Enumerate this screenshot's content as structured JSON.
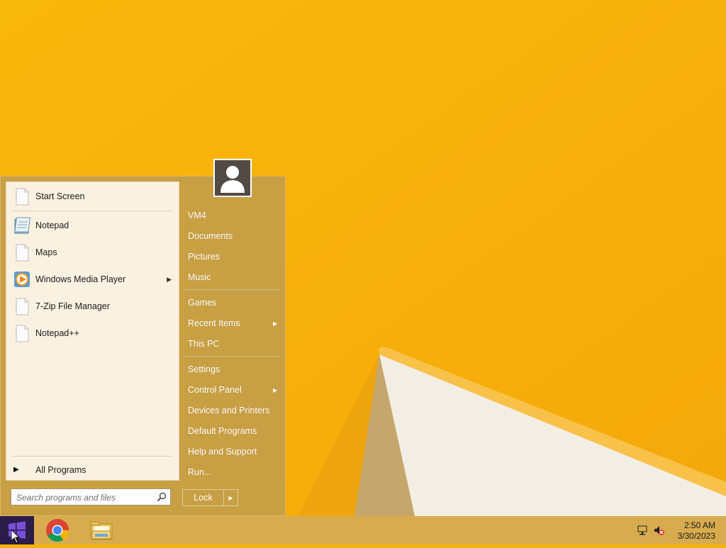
{
  "desktop": {
    "wallpaper_color": "#f7b20a"
  },
  "start_menu": {
    "programs": [
      {
        "label": "Start Screen",
        "icon": "document-icon",
        "has_submenu": false
      },
      {
        "label": "Notepad",
        "icon": "notepad-icon",
        "has_submenu": false
      },
      {
        "label": "Maps",
        "icon": "document-icon",
        "has_submenu": false
      },
      {
        "label": "Windows Media Player",
        "icon": "media-player-icon",
        "has_submenu": true
      },
      {
        "label": "7-Zip File Manager",
        "icon": "document-icon",
        "has_submenu": false
      },
      {
        "label": "Notepad++",
        "icon": "document-icon",
        "has_submenu": false
      }
    ],
    "all_programs_label": "All Programs",
    "search": {
      "placeholder": "Search programs and files",
      "value": ""
    },
    "right_items": [
      {
        "label": "VM4",
        "has_submenu": false
      },
      {
        "label": "Documents",
        "has_submenu": false
      },
      {
        "label": "Pictures",
        "has_submenu": false
      },
      {
        "label": "Music",
        "has_submenu": false
      },
      {
        "label": "Games",
        "has_submenu": false
      },
      {
        "label": "Recent Items",
        "has_submenu": true
      },
      {
        "label": "This PC",
        "has_submenu": false
      },
      {
        "label": "Settings",
        "has_submenu": false
      },
      {
        "label": "Control Panel",
        "has_submenu": true
      },
      {
        "label": "Devices and Printers",
        "has_submenu": false
      },
      {
        "label": "Default Programs",
        "has_submenu": false
      },
      {
        "label": "Help and Support",
        "has_submenu": false
      },
      {
        "label": "Run...",
        "has_submenu": false
      }
    ],
    "lock_label": "Lock"
  },
  "taskbar": {
    "pinned": [
      "chrome-icon",
      "file-explorer-icon"
    ],
    "tray_icons": [
      "network-icon",
      "volume-muted-icon"
    ],
    "clock": {
      "time": "2:50 AM",
      "date": "3/30/2023"
    }
  }
}
